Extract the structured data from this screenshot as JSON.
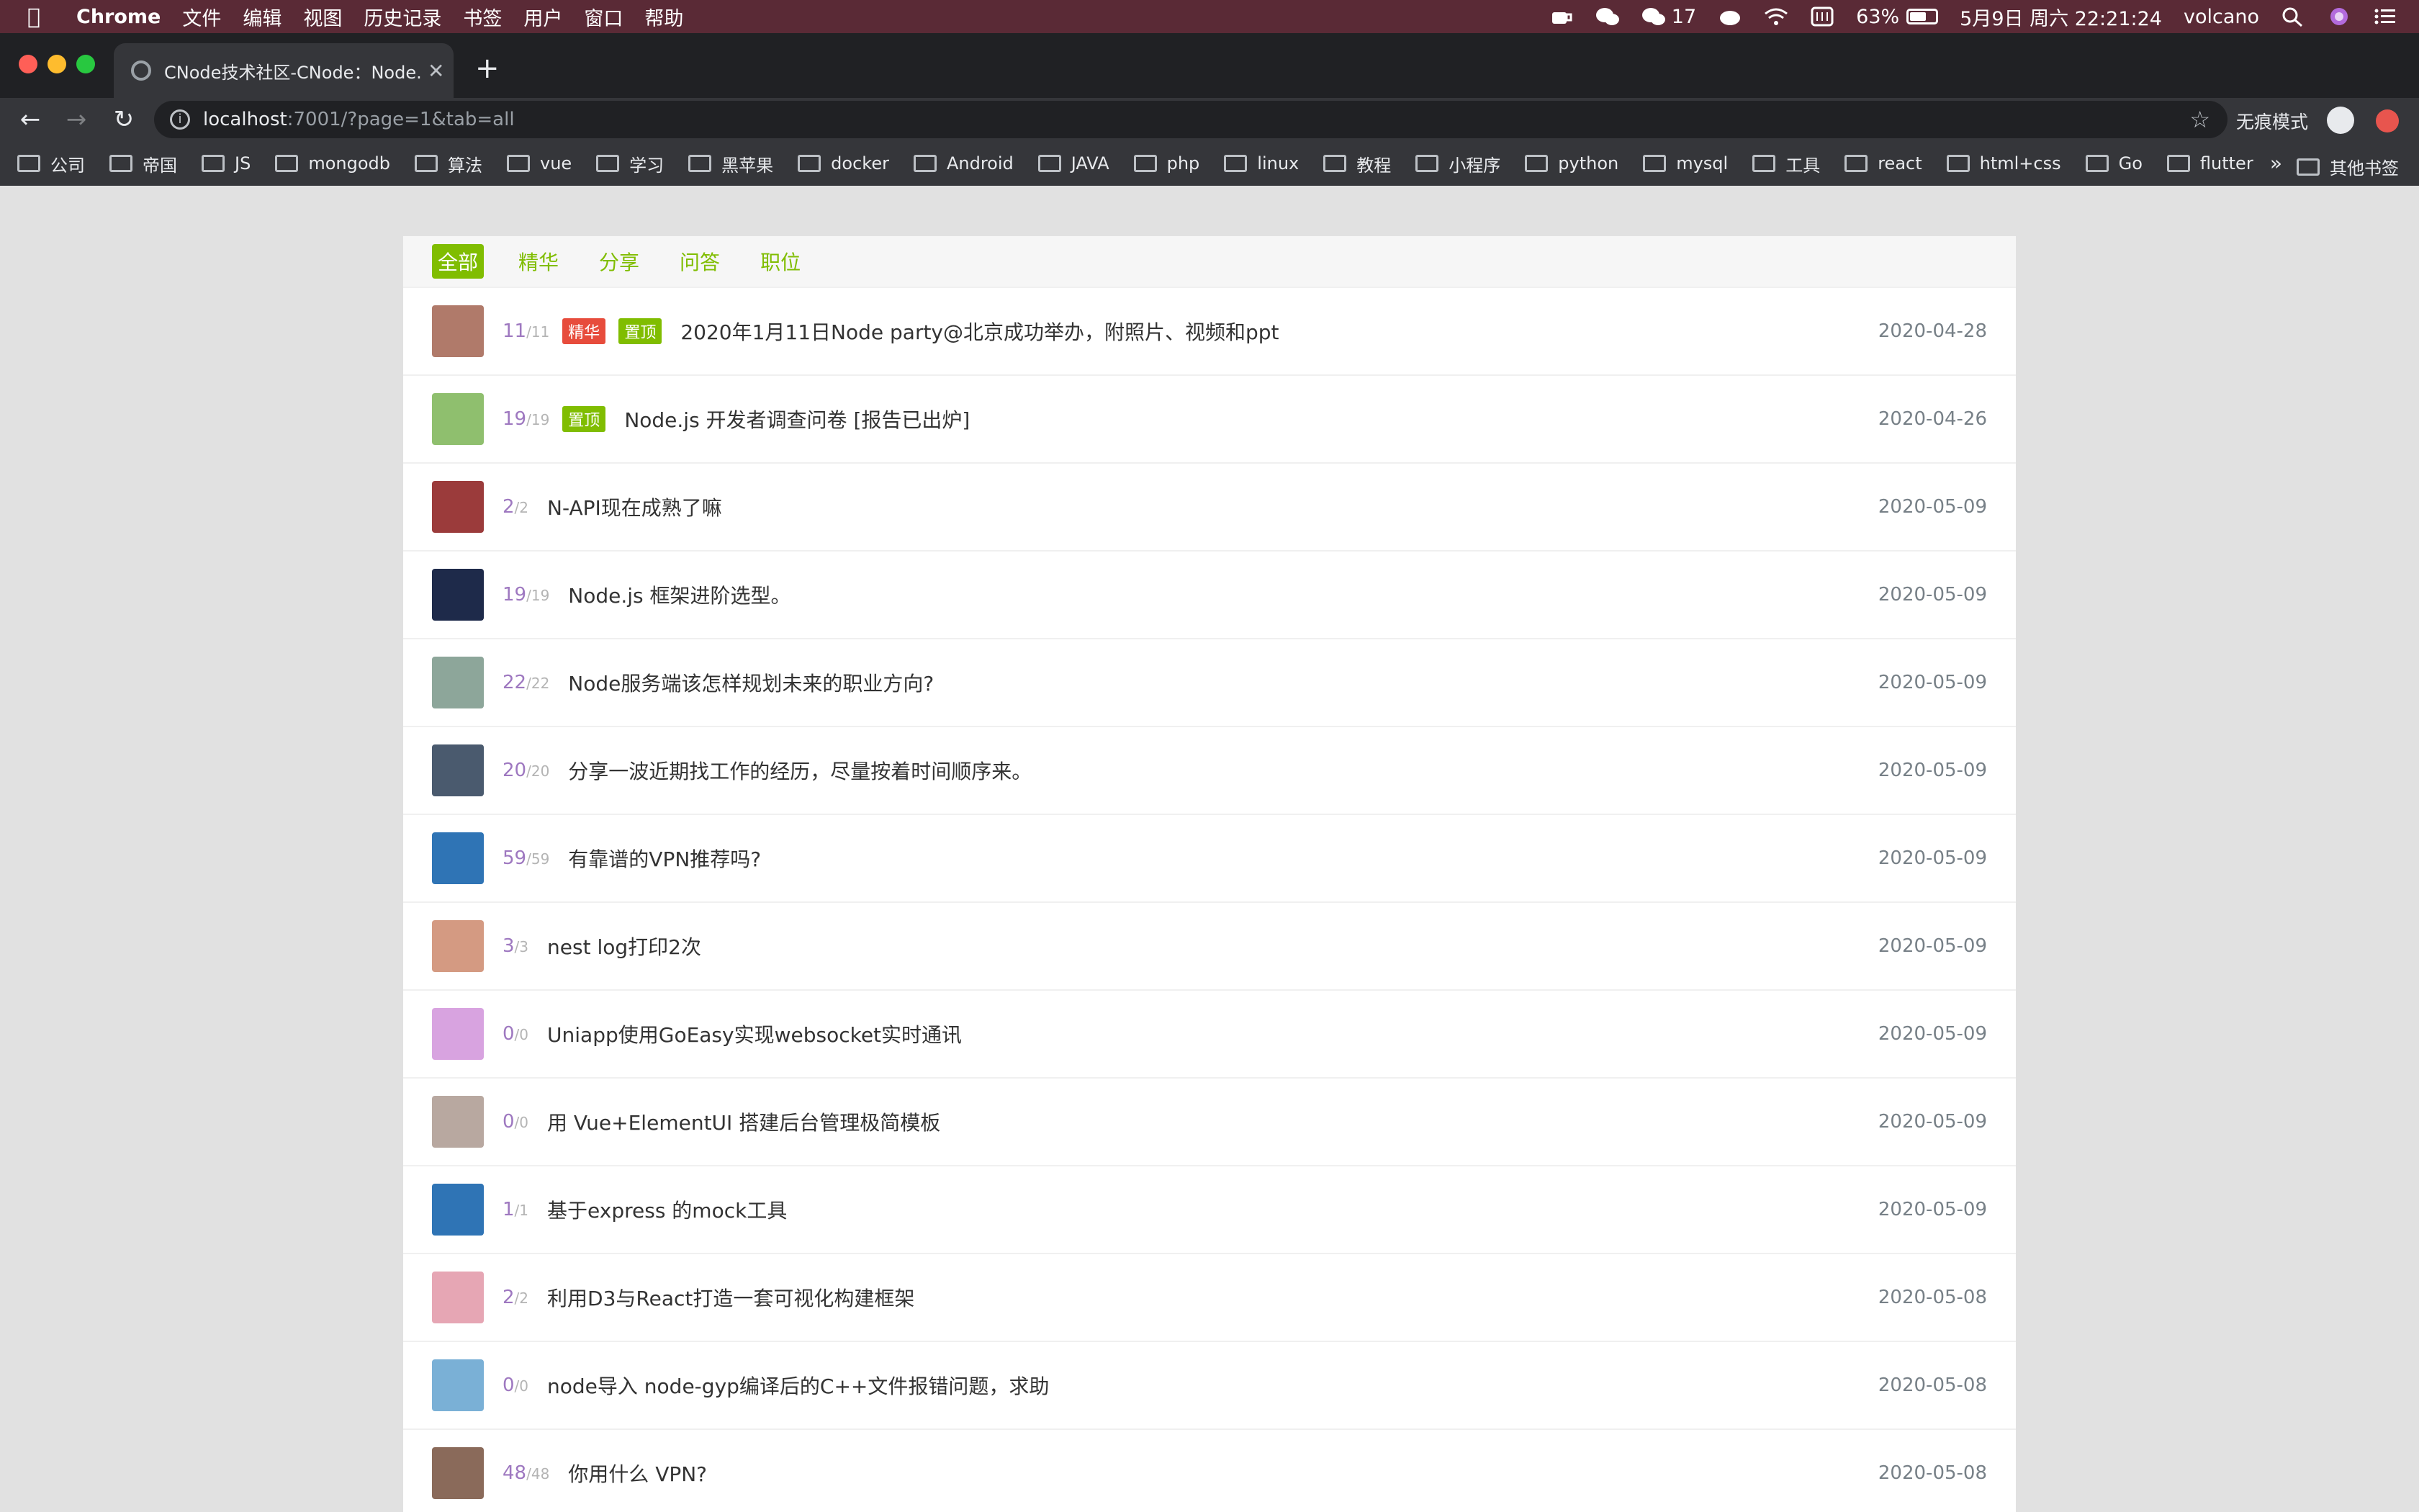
{
  "menubar": {
    "app": "Chrome",
    "items": [
      "文件",
      "编辑",
      "视图",
      "历史记录",
      "书签",
      "用户",
      "窗口",
      "帮助"
    ],
    "wechat_count": "17",
    "battery": "63%",
    "battery_level": 0.63,
    "datetime": "5月9日 周六 22:21:24",
    "user": "volcano"
  },
  "browser": {
    "tab_title": "CNode技术社区-CNode：Node.",
    "new_tab_icon": "+",
    "url_host": "localhost",
    "url_rest": ":7001/?page=1&tab=all",
    "incognito_label": "无痕模式",
    "bookmarks": [
      "公司",
      "帝国",
      "JS",
      "mongodb",
      "算法",
      "vue",
      "学习",
      "黑苹果",
      "docker",
      "Android",
      "JAVA",
      "php",
      "linux",
      "教程",
      "小程序",
      "python",
      "mysql",
      "工具",
      "react",
      "html+css",
      "Go",
      "flutter"
    ],
    "bookmarks_more": "»",
    "other_bookmarks": "其他书签"
  },
  "colors": {
    "menubar_bg": "#5a2a36",
    "accent_green": "#80bd01",
    "tag_good": "#e74c3c",
    "tag_top": "#80bd01"
  },
  "tabs": [
    "全部",
    "精华",
    "分享",
    "问答",
    "职位"
  ],
  "topics": [
    {
      "reply": "11",
      "visit": "11",
      "good": "精华",
      "top": "置顶",
      "title": "2020年1月11日Node party@北京成功举办，附照片、视频和ppt",
      "date": "2020-04-28",
      "avatar": "#b07a6a"
    },
    {
      "reply": "19",
      "visit": "19",
      "top": "置顶",
      "title": "Node.js 开发者调查问卷 [报告已出炉]",
      "date": "2020-04-26",
      "avatar": "#8fbf6e"
    },
    {
      "reply": "2",
      "visit": "2",
      "title": "N-API现在成熟了嘛",
      "date": "2020-05-09",
      "avatar": "#9b3b3b"
    },
    {
      "reply": "19",
      "visit": "19",
      "title": "Node.js 框架进阶选型。",
      "date": "2020-05-09",
      "avatar": "#1e2a4a"
    },
    {
      "reply": "22",
      "visit": "22",
      "title": "Node服务端该怎样规划未来的职业方向?",
      "date": "2020-05-09",
      "avatar": "#8da69a"
    },
    {
      "reply": "20",
      "visit": "20",
      "title": "分享一波近期找工作的经历，尽量按着时间顺序来。",
      "date": "2020-05-09",
      "avatar": "#4a5a6e"
    },
    {
      "reply": "59",
      "visit": "59",
      "title": "有靠谱的VPN推荐吗?",
      "date": "2020-05-09",
      "avatar": "#2f74b5"
    },
    {
      "reply": "3",
      "visit": "3",
      "title": "nest log打印2次",
      "date": "2020-05-09",
      "avatar": "#d49a82"
    },
    {
      "reply": "0",
      "visit": "0",
      "title": "Uniapp使用GoEasy实现websocket实时通讯",
      "date": "2020-05-09",
      "avatar": "#d8a3e0"
    },
    {
      "reply": "0",
      "visit": "0",
      "title": "用 Vue+ElementUI 搭建后台管理极简模板",
      "date": "2020-05-09",
      "avatar": "#b8a8a0"
    },
    {
      "reply": "1",
      "visit": "1",
      "title": "基于express 的mock工具",
      "date": "2020-05-09",
      "avatar": "#2f74b5"
    },
    {
      "reply": "2",
      "visit": "2",
      "title": "利用D3与React打造一套可视化构建框架",
      "date": "2020-05-08",
      "avatar": "#e6a6b4"
    },
    {
      "reply": "0",
      "visit": "0",
      "title": "node导入 node-gyp编译后的C++文件报错问题，求助",
      "date": "2020-05-08",
      "avatar": "#7ab0d6"
    },
    {
      "reply": "48",
      "visit": "48",
      "title": "你用什么 VPN?",
      "date": "2020-05-08",
      "avatar": "#8a6a5a"
    }
  ]
}
